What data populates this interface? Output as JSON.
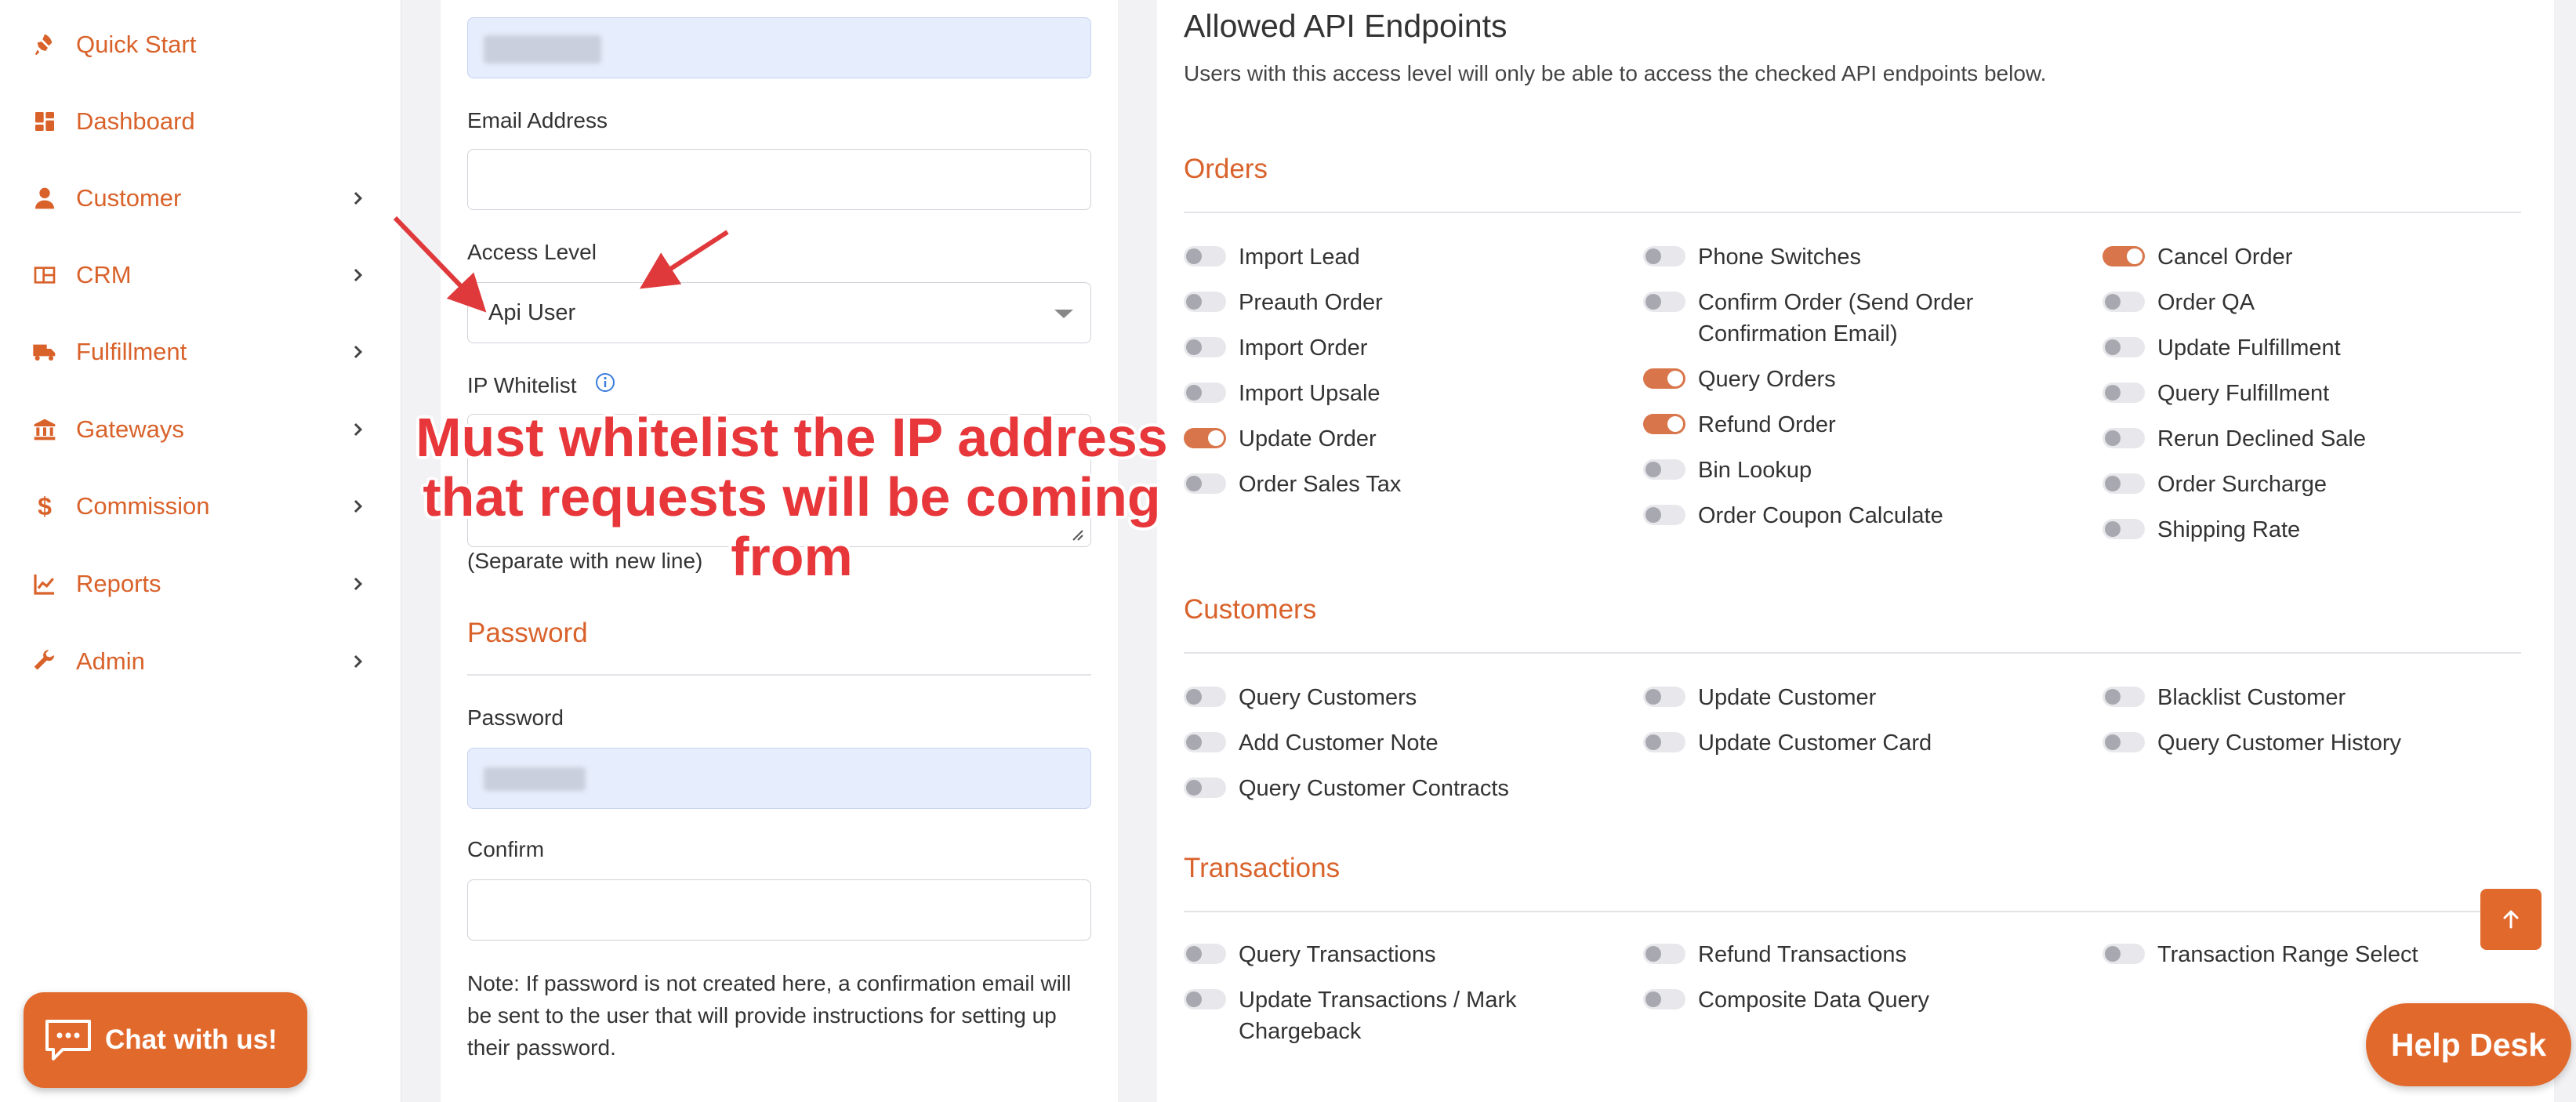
{
  "sidebar": {
    "items": [
      {
        "label": "Quick Start",
        "icon": "rocket-icon",
        "has_chevron": false
      },
      {
        "label": "Dashboard",
        "icon": "dashboard-icon",
        "has_chevron": false
      },
      {
        "label": "Customer",
        "icon": "user-icon",
        "has_chevron": true
      },
      {
        "label": "CRM",
        "icon": "crm-icon",
        "has_chevron": true
      },
      {
        "label": "Fulfillment",
        "icon": "truck-icon",
        "has_chevron": true
      },
      {
        "label": "Gateways",
        "icon": "bank-icon",
        "has_chevron": true
      },
      {
        "label": "Commission",
        "icon": "dollar-icon",
        "has_chevron": true
      },
      {
        "label": "Reports",
        "icon": "chart-icon",
        "has_chevron": true
      },
      {
        "label": "Admin",
        "icon": "wrench-icon",
        "has_chevron": true
      }
    ],
    "chat_button": "Chat with us!"
  },
  "form": {
    "email_label": "Email Address",
    "email_value": "",
    "access_level_label": "Access Level",
    "access_level_value": "Api User",
    "ip_whitelist_label": "IP Whitelist",
    "ip_whitelist_hint": "(Separate with new line)",
    "password_section": "Password",
    "password_label": "Password",
    "confirm_label": "Confirm",
    "note": "Note: If password is not created here, a confirmation email will be sent to the user that will provide instructions for setting up their password."
  },
  "endpoints": {
    "title": "Allowed API Endpoints",
    "description": "Users with this access level will only be able to access the checked API endpoints below.",
    "sections": {
      "orders": {
        "title": "Orders",
        "columns": [
          [
            {
              "label": "Import Lead",
              "on": false
            },
            {
              "label": "Preauth Order",
              "on": false
            },
            {
              "label": "Import Order",
              "on": false
            },
            {
              "label": "Import Upsale",
              "on": false
            },
            {
              "label": "Update Order",
              "on": true
            },
            {
              "label": "Order Sales Tax",
              "on": false
            }
          ],
          [
            {
              "label": "Phone Switches",
              "on": false
            },
            {
              "label": "Confirm Order (Send Order Confirmation Email)",
              "on": false
            },
            {
              "label": "Query Orders",
              "on": true
            },
            {
              "label": "Refund Order",
              "on": true
            },
            {
              "label": "Bin Lookup",
              "on": false
            },
            {
              "label": "Order Coupon Calculate",
              "on": false
            }
          ],
          [
            {
              "label": "Cancel Order",
              "on": true
            },
            {
              "label": "Order QA",
              "on": false
            },
            {
              "label": "Update Fulfillment",
              "on": false
            },
            {
              "label": "Query Fulfillment",
              "on": false
            },
            {
              "label": "Rerun Declined Sale",
              "on": false
            },
            {
              "label": "Order Surcharge",
              "on": false
            },
            {
              "label": "Shipping Rate",
              "on": false
            }
          ]
        ]
      },
      "customers": {
        "title": "Customers",
        "columns": [
          [
            {
              "label": "Query Customers",
              "on": false
            },
            {
              "label": "Add Customer Note",
              "on": false
            },
            {
              "label": "Query Customer Contracts",
              "on": false
            }
          ],
          [
            {
              "label": "Update Customer",
              "on": false
            },
            {
              "label": "Update Customer Card",
              "on": false
            }
          ],
          [
            {
              "label": "Blacklist Customer",
              "on": false
            },
            {
              "label": "Query Customer History",
              "on": false
            }
          ]
        ]
      },
      "transactions": {
        "title": "Transactions",
        "columns": [
          [
            {
              "label": "Query Transactions",
              "on": false
            },
            {
              "label": "Update Transactions / Mark Chargeback",
              "on": false
            }
          ],
          [
            {
              "label": "Refund Transactions",
              "on": false
            },
            {
              "label": "Composite Data Query",
              "on": false
            }
          ],
          [
            {
              "label": "Transaction Range Select",
              "on": false
            }
          ]
        ]
      }
    }
  },
  "annotation": {
    "text": "Must whitelist the IP address that requests will be coming from"
  },
  "floating": {
    "help_desk": "Help Desk"
  },
  "colors": {
    "accent": "#d9622b",
    "button": "#e2692c",
    "annotation": "#e8373a",
    "filled_input": "#e6edfc"
  }
}
